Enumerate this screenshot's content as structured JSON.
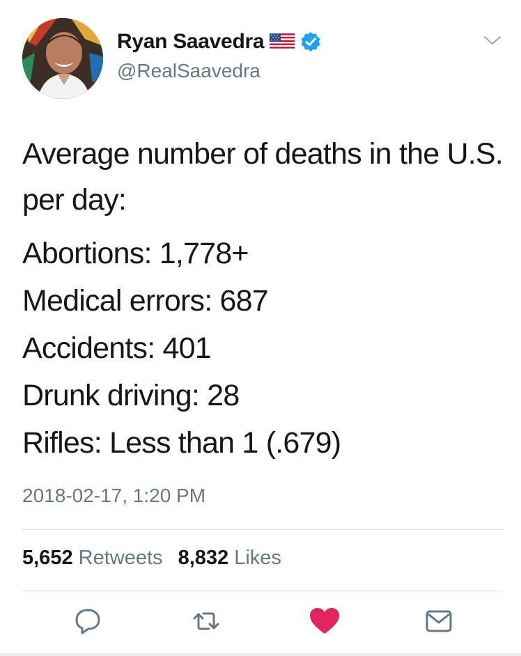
{
  "author": {
    "name": "Ryan Saavedra",
    "handle": "@RealSaavedra",
    "flag_icon": "us-flag-icon",
    "verified_icon": "verified-badge-icon"
  },
  "tweet": {
    "intro": "Average number of deaths in the U.S. per day:",
    "stats": [
      "Abortions: 1,778+",
      "Medical errors: 687",
      "Accidents: 401",
      "Drunk driving: 28",
      "Rifles: Less than 1 (.679)"
    ],
    "timestamp": "2018-02-17, 1:20 PM"
  },
  "engagement": {
    "retweets_count": "5,652",
    "retweets_label": "Retweets",
    "likes_count": "8,832",
    "likes_label": "Likes"
  },
  "actions": [
    "reply-icon",
    "retweet-icon",
    "like-heart-icon",
    "direct-message-icon"
  ],
  "colors": {
    "text": "#14171a",
    "secondary": "#657786",
    "verified_blue": "#1da1f2",
    "like_red": "#e0245e"
  }
}
